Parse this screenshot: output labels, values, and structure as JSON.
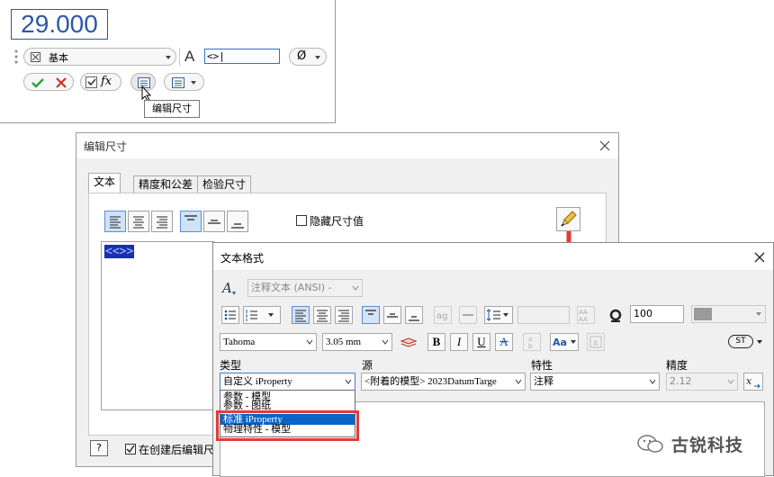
{
  "top_panel": {
    "dimension_value": "29.000",
    "style_combo": "基本",
    "text_field": "<>|",
    "diameter_symbol": "Ø",
    "tooltip": "编辑尺寸",
    "fx_label": "fx"
  },
  "edit_dialog": {
    "title": "编辑尺寸",
    "tabs": [
      "文本",
      "精度和公差",
      "检验尺寸"
    ],
    "hide_value_label": "隐藏尺寸值",
    "editor_text": "<<>>",
    "edit_after_create_label": "在创建后编辑尺寸",
    "help_label": "?"
  },
  "format_dialog": {
    "title": "文本格式",
    "style_combo": "注释文本 (ANSI) -",
    "stretch_value": "100",
    "font_combo": "Tahoma",
    "size_combo": "3.05 mm",
    "st_label": "ST",
    "labels": {
      "type": "类型",
      "source": "源",
      "property": "特性",
      "precision": "精度"
    },
    "type_combo": "自定义 iProperty",
    "source_combo": "<附着的模型> 2023DatumTarge",
    "property_combo": "注释",
    "precision_combo": "2.12",
    "type_options": [
      "参数 - 模型",
      "参数 - 图纸",
      "标准 iProperty",
      "物理特性 - 模型"
    ],
    "type_options_selected_index": 2
  },
  "watermark": "古锐科技",
  "colors": {
    "accent_blue": "#2d57a8",
    "highlight_red": "#e23b3b",
    "selection_blue": "#0a64c8"
  }
}
